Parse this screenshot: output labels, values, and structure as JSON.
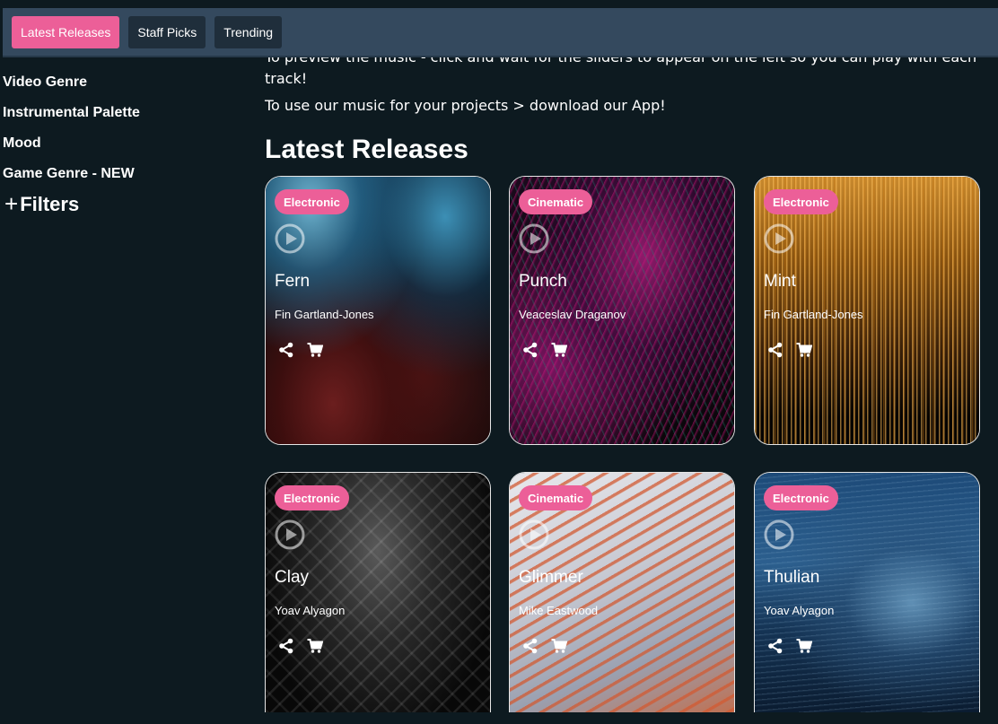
{
  "tabs": [
    {
      "label": "Latest Releases",
      "active": true
    },
    {
      "label": "Staff Picks",
      "active": false
    },
    {
      "label": "Trending",
      "active": false
    }
  ],
  "intro": {
    "line1_partial": "To preview the music - click and wait for the sliders to appear on the left so you can play with each",
    "line1_end": "track!",
    "line2": "To use our music for your projects > download our App!"
  },
  "sidebar": {
    "items": [
      "Video Genre",
      "Instrumental Palette",
      "Mood",
      "Game Genre - NEW"
    ],
    "filters_label": "Filters"
  },
  "section_title": "Latest Releases",
  "cards": [
    {
      "genre": "Electronic",
      "title": "Fern",
      "artist": "Fin Gartland-Jones"
    },
    {
      "genre": "Cinematic",
      "title": "Punch",
      "artist": "Veaceslav Draganov"
    },
    {
      "genre": "Electronic",
      "title": "Mint",
      "artist": "Fin Gartland-Jones"
    },
    {
      "genre": "Electronic",
      "title": "Clay",
      "artist": "Yoav Alyagon"
    },
    {
      "genre": "Cinematic",
      "title": "Glimmer",
      "artist": "Mike Eastwood"
    },
    {
      "genre": "Electronic",
      "title": "Thulian",
      "artist": "Yoav Alyagon"
    }
  ],
  "colors": {
    "accent": "#ec5f98",
    "background": "#0d1a20",
    "tabbar": "#34495e"
  }
}
